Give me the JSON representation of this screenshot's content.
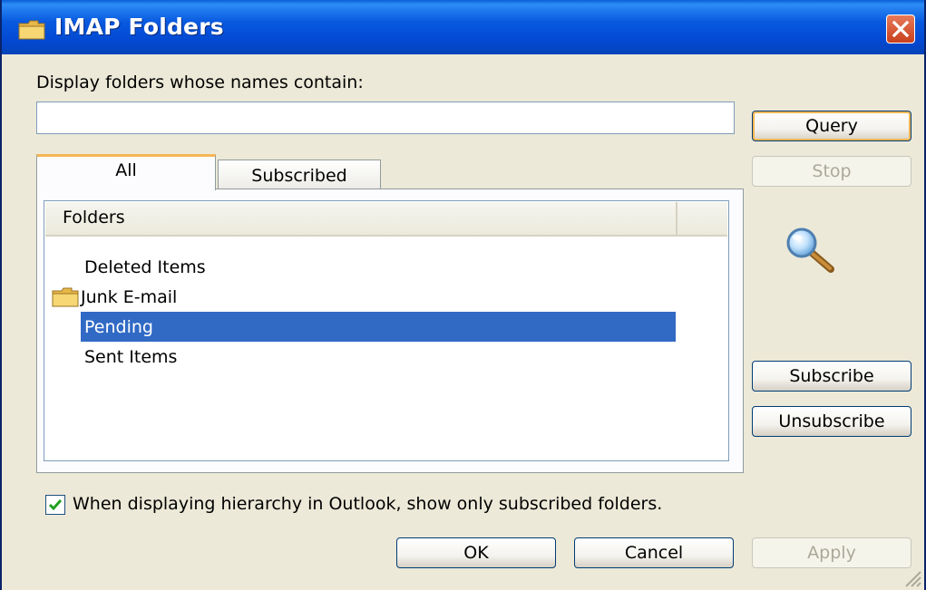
{
  "window": {
    "title": "IMAP Folders",
    "icon": "folder-icon",
    "close_icon": "close-icon"
  },
  "filter": {
    "label": "Display folders whose names contain:",
    "value": "",
    "placeholder": ""
  },
  "buttons": {
    "query": "Query",
    "stop": "Stop",
    "subscribe": "Subscribe",
    "unsubscribe": "Unsubscribe",
    "ok": "OK",
    "cancel": "Cancel",
    "apply": "Apply"
  },
  "tabs": [
    {
      "label": "All",
      "selected": true
    },
    {
      "label": "Subscribed",
      "selected": false
    }
  ],
  "list": {
    "column_header": "Folders",
    "items": [
      {
        "label": "Deleted Items",
        "icon": "none",
        "selected": false
      },
      {
        "label": "Junk E-mail",
        "icon": "folder-icon",
        "selected": false
      },
      {
        "label": "Pending",
        "icon": "none",
        "selected": true
      },
      {
        "label": "Sent Items",
        "icon": "none",
        "selected": false
      }
    ]
  },
  "option": {
    "checked": true,
    "label": "When displaying hierarchy in Outlook, show only subscribed folders."
  },
  "colors": {
    "titlebar": "#0859df",
    "dialog_bg": "#ece9d8",
    "selection": "#316ac5",
    "default_button_highlight": "#f4b654",
    "close_button": "#c9401c"
  }
}
